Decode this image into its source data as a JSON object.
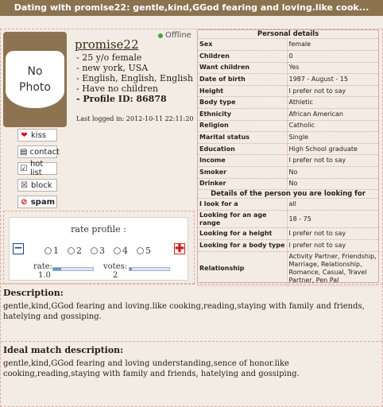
{
  "page_title": "Dating with promise22: gentle,kind,GGod fearing and loving.like cook...",
  "profile": {
    "photo_text_1": "No",
    "photo_text_2": "Photo",
    "name": "promise22",
    "status": "Offline",
    "facts": [
      "- 25 y/o female",
      "- new york, USA",
      "- English, English, English",
      "- Have no children"
    ],
    "profile_id": "- Profile ID:  86878",
    "last_logged": "Last logged in: 2012-10-11 22:11:20"
  },
  "actions": [
    {
      "label": "kiss",
      "icon": "heart-icon"
    },
    {
      "label": "contact",
      "icon": "chat-icon"
    },
    {
      "label": "hot list",
      "icon": "checkbox-icon"
    },
    {
      "label": "block",
      "icon": "cross-box-icon"
    },
    {
      "label": "spam",
      "icon": "no-sign-icon"
    }
  ],
  "rating": {
    "title": "rate profile :",
    "options": [
      "1",
      "2",
      "3",
      "4",
      "5"
    ],
    "minus": "−",
    "plus": "✚",
    "rate_label": "rate:",
    "rate_value": "1.0",
    "votes_label": "votes:",
    "votes_value": "2",
    "rate_fraction": 0.2,
    "votes_fraction": 0.05
  },
  "personal_details": {
    "heading": "Personal details",
    "rows": [
      {
        "key": "Sex",
        "value": "female"
      },
      {
        "key": "Children",
        "value": "0"
      },
      {
        "key": "Want children",
        "value": "Yes"
      },
      {
        "key": "Date of birth",
        "value": "1987 - August - 15"
      },
      {
        "key": "Height",
        "value": "I prefer not to say"
      },
      {
        "key": "Body type",
        "value": "Athletic"
      },
      {
        "key": "Ethnicity",
        "value": "African American"
      },
      {
        "key": "Religion",
        "value": "Catholic"
      },
      {
        "key": "Marital status",
        "value": "Single"
      },
      {
        "key": "Education",
        "value": "High School graduate"
      },
      {
        "key": "Income",
        "value": "I prefer not to say"
      },
      {
        "key": "Smoker",
        "value": "No"
      },
      {
        "key": "Drinker",
        "value": "No"
      }
    ]
  },
  "looking_for": {
    "heading": "Details of the person you are looking for",
    "rows": [
      {
        "key": "I look for a",
        "value": "all"
      },
      {
        "key": "Looking for an age range",
        "value": "18 -  75"
      },
      {
        "key": "Looking for a height",
        "value": "I prefer not to say"
      },
      {
        "key": "Looking for a body type",
        "value": "I prefer not to say"
      },
      {
        "key": "Relationship",
        "value": "Activity Partner, Friendship, Marriage, Relationship, Romance, Casual, Travel Partner, Pen Pal"
      }
    ]
  },
  "description": {
    "heading": "Description:",
    "text": "gentle,kind,GGod fearing and loving.like cooking,reading,staying with family and friends, hatelying and gossiping."
  },
  "ideal_match": {
    "heading": "Ideal match description:",
    "text": "gentle,kind,GGod fearing and loving understanding,sence of honor.like cooking,reading,staying with family and friends, hatelying and gossiping."
  },
  "colors": {
    "title_bar": "#8b7350",
    "background": "#f3ece4",
    "border": "#d9aaa4"
  }
}
